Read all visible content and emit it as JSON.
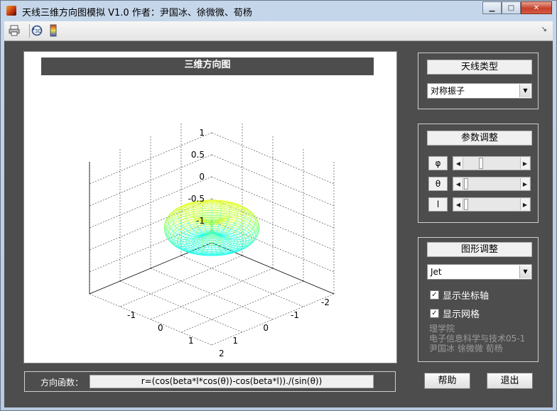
{
  "window": {
    "title": "天线三维方向图模拟 V1.0 作者：尹国冰、徐微微、荀杨"
  },
  "toolbar": {
    "items": [
      "print-icon",
      "rotate-3d-icon",
      "colorbar-icon"
    ]
  },
  "plot": {
    "title": "三维方向图",
    "z_ticks": [
      "1",
      "0.5",
      "0",
      "-0.5",
      "-1"
    ],
    "x_ticks": [
      "1",
      "0",
      "-1",
      "-2"
    ],
    "y_ticks": [
      "-1",
      "0",
      "1",
      "2"
    ]
  },
  "function_bar": {
    "label": "方向函数：",
    "value": "r=(cos(beta*l*cos(θ))-cos(beta*l))./(sin(θ))"
  },
  "antenna_panel": {
    "title": "天线类型",
    "selected": "对称振子"
  },
  "params_panel": {
    "title": "参数调整",
    "sliders": [
      {
        "label": "φ",
        "value": 0.3
      },
      {
        "label": "θ",
        "value": 0.02
      },
      {
        "label": "l",
        "value": 0.02
      }
    ]
  },
  "figure_panel": {
    "title": "图形调整",
    "colormap": "Jet",
    "show_axes": "显示坐标轴",
    "show_grid": "显示网格",
    "info_lines": [
      "理学院",
      "电子信息科学与技术05-1",
      "尹国冰 徐微微 荀杨"
    ]
  },
  "buttons": {
    "help": "帮助",
    "exit": "退出"
  }
}
